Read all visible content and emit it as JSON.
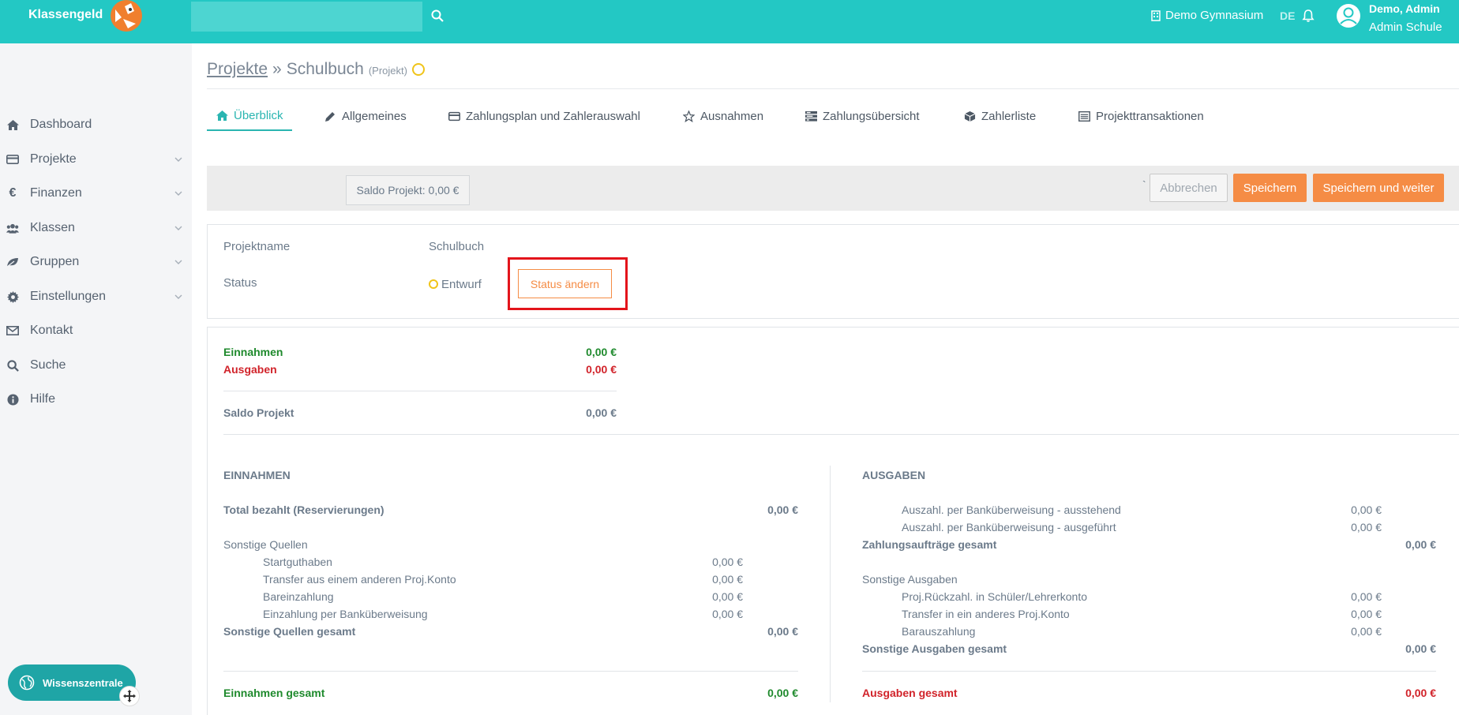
{
  "topbar": {
    "brand": "Klassengeld",
    "search_placeholder": "",
    "school": "Demo Gymnasium",
    "language": "DE",
    "user_name": "Demo, Admin",
    "user_role": "Admin Schule"
  },
  "sidebar": {
    "items": [
      {
        "label": "Dashboard",
        "icon": "home-icon"
      },
      {
        "label": "Projekte",
        "icon": "credit-card-icon"
      },
      {
        "label": "Finanzen",
        "icon": "euro-icon"
      },
      {
        "label": "Klassen",
        "icon": "users-icon"
      },
      {
        "label": "Gruppen",
        "icon": "leaf-icon"
      },
      {
        "label": "Einstellungen",
        "icon": "gear-icon"
      },
      {
        "label": "Kontakt",
        "icon": "envelope-icon"
      },
      {
        "label": "Suche",
        "icon": "search-icon"
      },
      {
        "label": "Hilfe",
        "icon": "info-icon"
      }
    ],
    "wissenszentrale": "Wissenszentrale"
  },
  "breadcrumb": {
    "parent": "Projekte",
    "separator": "»",
    "current": "Schulbuch",
    "type": "(Projekt)"
  },
  "tabs": [
    {
      "label": "Überblick",
      "icon": "home-icon"
    },
    {
      "label": "Allgemeines",
      "icon": "pencil-icon"
    },
    {
      "label": "Zahlungsplan und Zahlerauswahl",
      "icon": "credit-card-icon"
    },
    {
      "label": "Ausnahmen",
      "icon": "star-icon"
    },
    {
      "label": "Zahlungsübersicht",
      "icon": "tasks-icon"
    },
    {
      "label": "Zahlerliste",
      "icon": "cube-icon"
    },
    {
      "label": "Projekttransaktionen",
      "icon": "list-icon"
    }
  ],
  "actionbar": {
    "saldo": "Saldo Projekt: 0,00 €",
    "backtick": "`",
    "cancel": "Abbrechen",
    "save": "Speichern",
    "save_next": "Speichern und weiter"
  },
  "project": {
    "name_label": "Projektname",
    "name_value": "Schulbuch",
    "status_label": "Status",
    "status_value": "Entwurf",
    "change_status": "Status ändern"
  },
  "summary": {
    "einnahmen_label": "Einnahmen",
    "einnahmen_value": "0,00 €",
    "ausgaben_label": "Ausgaben",
    "ausgaben_value": "0,00 €",
    "saldo_label": "Saldo Projekt",
    "saldo_value": "0,00 €"
  },
  "income": {
    "heading": "EINNAHMEN",
    "total_paid_label": "Total bezahlt (Reservierungen)",
    "total_paid_value": "0,00 €",
    "other_label": "Sonstige Quellen",
    "rows": [
      {
        "label": "Startguthaben",
        "value": "0,00 €"
      },
      {
        "label": "Transfer aus einem anderen Proj.Konto",
        "value": "0,00 €"
      },
      {
        "label": "Bareinzahlung",
        "value": "0,00 €"
      },
      {
        "label": "Einzahlung per Banküberweisung",
        "value": "0,00 €"
      }
    ],
    "other_total_label": "Sonstige Quellen gesamt",
    "other_total_value": "0,00 €",
    "grand_total_label": "Einnahmen gesamt",
    "grand_total_value": "0,00 €"
  },
  "expenses": {
    "heading": "AUSGABEN",
    "payment_rows": [
      {
        "label": "Auszahl. per Banküberweisung - ausstehend",
        "value": "0,00 €"
      },
      {
        "label": "Auszahl. per Banküberweisung - ausgeführt",
        "value": "0,00 €"
      }
    ],
    "payment_total_label": "Zahlungsaufträge gesamt",
    "payment_total_value": "0,00 €",
    "other_label": "Sonstige Ausgaben",
    "other_rows": [
      {
        "label": "Proj.Rückzahl. in Schüler/Lehrerkonto",
        "value": "0,00 €"
      },
      {
        "label": "Transfer in ein anderes Proj.Konto",
        "value": "0,00 €"
      },
      {
        "label": "Barauszahlung",
        "value": "0,00 €"
      }
    ],
    "other_total_label": "Sonstige Ausgaben gesamt",
    "other_total_value": "0,00 €",
    "grand_total_label": "Ausgaben gesamt",
    "grand_total_value": "0,00 €"
  },
  "colors": {
    "brand": "#23c8c4",
    "accent": "#f58c45",
    "positive": "#1f8a2d",
    "negative": "#d1232a",
    "highlight": "#e3141b"
  }
}
